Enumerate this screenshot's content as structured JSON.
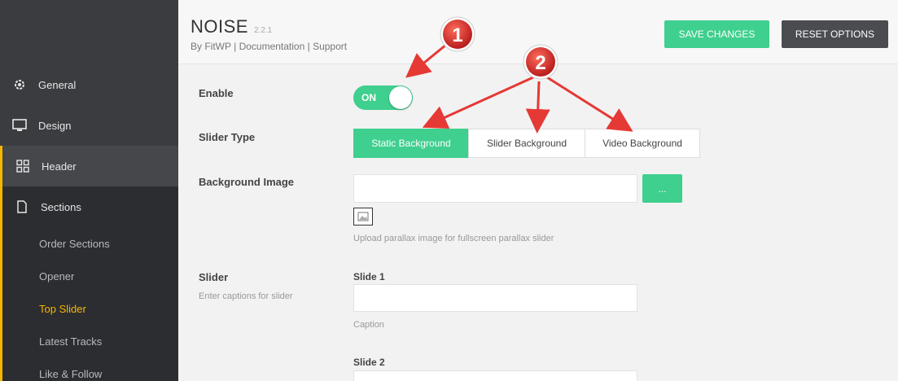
{
  "sidebar": {
    "items": [
      {
        "label": "General",
        "icon": "gear-icon"
      },
      {
        "label": "Design",
        "icon": "monitor-icon"
      },
      {
        "label": "Header",
        "icon": "grid-icon"
      },
      {
        "label": "Sections",
        "icon": "page-icon"
      }
    ],
    "subitems": [
      "Order Sections",
      "Opener",
      "Top Slider",
      "Latest Tracks",
      "Like & Follow"
    ],
    "accent_color": "#f7b500"
  },
  "header": {
    "title": "NOISE",
    "version": "2.2.1",
    "byline": "By FitWP | Documentation | Support",
    "save_label": "SAVE CHANGES",
    "reset_label": "RESET OPTIONS"
  },
  "form": {
    "enable_label": "Enable",
    "toggle_text": "ON",
    "slider_type_label": "Slider Type",
    "slider_types": [
      "Static Background",
      "Slider Background",
      "Video Background"
    ],
    "bg_image_label": "Background Image",
    "browse_label": "...",
    "upload_help": "Upload parallax image for fullscreen parallax slider",
    "slider_label": "Slider",
    "slider_help": "Enter captions for slider",
    "slide1_label": "Slide 1",
    "caption_help": "Caption",
    "slide2_label": "Slide 2"
  },
  "annotations": [
    "1",
    "2"
  ],
  "colors": {
    "primary": "#3fcf8e",
    "annotation": "#e53935"
  }
}
